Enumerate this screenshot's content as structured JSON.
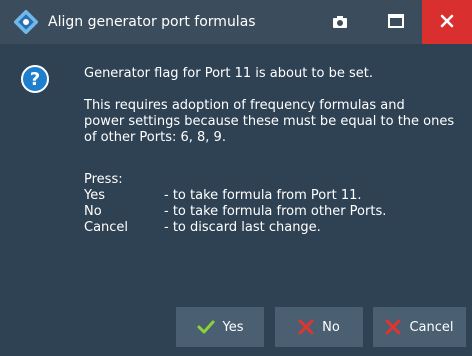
{
  "window": {
    "title": "Align generator port formulas"
  },
  "message": {
    "line1": "Generator flag for Port 11 is about to be set.",
    "line2": "This requires adoption of frequency formulas and",
    "line3": "power settings because these must be equal to the ones",
    "line4": "of other Ports: 6, 8, 9.",
    "press": "Press:",
    "options": [
      {
        "key": "Yes",
        "desc": "- to take formula from Port 11."
      },
      {
        "key": "No",
        "desc": "- to take formula from other Ports."
      },
      {
        "key": "Cancel",
        "desc": "- to discard last change."
      }
    ]
  },
  "buttons": {
    "yes": "Yes",
    "no": "No",
    "cancel": "Cancel"
  },
  "icons": {
    "title_logo": "rohde-schwarz-logo-icon",
    "camera": "camera-icon",
    "maximize": "maximize-icon",
    "close": "close-icon",
    "question": "question-icon",
    "check": "check-icon",
    "x": "x-icon"
  },
  "colors": {
    "close_bg": "#d9302f",
    "check_green": "#8cd23a",
    "x_red": "#e2342f",
    "question_blue": "#1e7fcf"
  }
}
